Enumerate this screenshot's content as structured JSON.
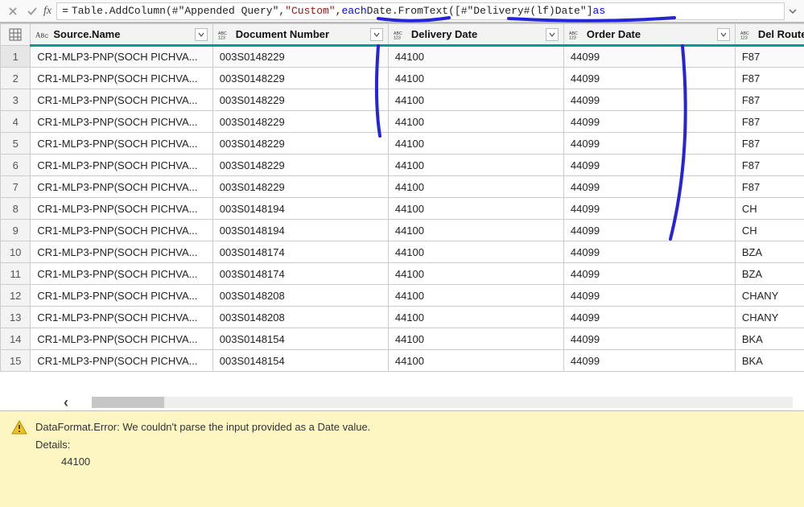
{
  "formula": {
    "prefix": "= ",
    "fn1": "Table.AddColumn",
    "open1": "(",
    "arg1": "#\"Appended Query\"",
    "comma1": ", ",
    "arg2": "\"Custom\"",
    "comma2": ", ",
    "each": "each",
    "sp": " ",
    "fn2": "Date.FromText",
    "open2": "(",
    "arg3": "[#\"Delivery#(lf)Date\"]",
    "sp2": " ",
    "as": "as"
  },
  "columns": {
    "c0": {
      "label": "Source.Name"
    },
    "c1": {
      "label": "Document Number"
    },
    "c2": {
      "label": "Delivery Date"
    },
    "c3": {
      "label": "Order Date"
    },
    "c4": {
      "label": "Del Route"
    }
  },
  "rows": [
    {
      "n": "1",
      "a": "CR1-MLP3-PNP(SOCH PICHVA...",
      "b": "003S0148229",
      "c": "44100",
      "d": "44099",
      "e": "F87"
    },
    {
      "n": "2",
      "a": "CR1-MLP3-PNP(SOCH PICHVA...",
      "b": "003S0148229",
      "c": "44100",
      "d": "44099",
      "e": "F87"
    },
    {
      "n": "3",
      "a": "CR1-MLP3-PNP(SOCH PICHVA...",
      "b": "003S0148229",
      "c": "44100",
      "d": "44099",
      "e": "F87"
    },
    {
      "n": "4",
      "a": "CR1-MLP3-PNP(SOCH PICHVA...",
      "b": "003S0148229",
      "c": "44100",
      "d": "44099",
      "e": "F87"
    },
    {
      "n": "5",
      "a": "CR1-MLP3-PNP(SOCH PICHVA...",
      "b": "003S0148229",
      "c": "44100",
      "d": "44099",
      "e": "F87"
    },
    {
      "n": "6",
      "a": "CR1-MLP3-PNP(SOCH PICHVA...",
      "b": "003S0148229",
      "c": "44100",
      "d": "44099",
      "e": "F87"
    },
    {
      "n": "7",
      "a": "CR1-MLP3-PNP(SOCH PICHVA...",
      "b": "003S0148229",
      "c": "44100",
      "d": "44099",
      "e": "F87"
    },
    {
      "n": "8",
      "a": "CR1-MLP3-PNP(SOCH PICHVA...",
      "b": "003S0148194",
      "c": "44100",
      "d": "44099",
      "e": "CH"
    },
    {
      "n": "9",
      "a": "CR1-MLP3-PNP(SOCH PICHVA...",
      "b": "003S0148194",
      "c": "44100",
      "d": "44099",
      "e": "CH"
    },
    {
      "n": "10",
      "a": "CR1-MLP3-PNP(SOCH PICHVA...",
      "b": "003S0148174",
      "c": "44100",
      "d": "44099",
      "e": "BZA"
    },
    {
      "n": "11",
      "a": "CR1-MLP3-PNP(SOCH PICHVA...",
      "b": "003S0148174",
      "c": "44100",
      "d": "44099",
      "e": "BZA"
    },
    {
      "n": "12",
      "a": "CR1-MLP3-PNP(SOCH PICHVA...",
      "b": "003S0148208",
      "c": "44100",
      "d": "44099",
      "e": "CHANY"
    },
    {
      "n": "13",
      "a": "CR1-MLP3-PNP(SOCH PICHVA...",
      "b": "003S0148208",
      "c": "44100",
      "d": "44099",
      "e": "CHANY"
    },
    {
      "n": "14",
      "a": "CR1-MLP3-PNP(SOCH PICHVA...",
      "b": "003S0148154",
      "c": "44100",
      "d": "44099",
      "e": "BKA"
    },
    {
      "n": "15",
      "a": "CR1-MLP3-PNP(SOCH PICHVA...",
      "b": "003S0148154",
      "c": "44100",
      "d": "44099",
      "e": "BKA"
    }
  ],
  "error": {
    "message": "DataFormat.Error: We couldn't parse the input provided as a Date value.",
    "details_label": "Details:",
    "value": "44100"
  }
}
